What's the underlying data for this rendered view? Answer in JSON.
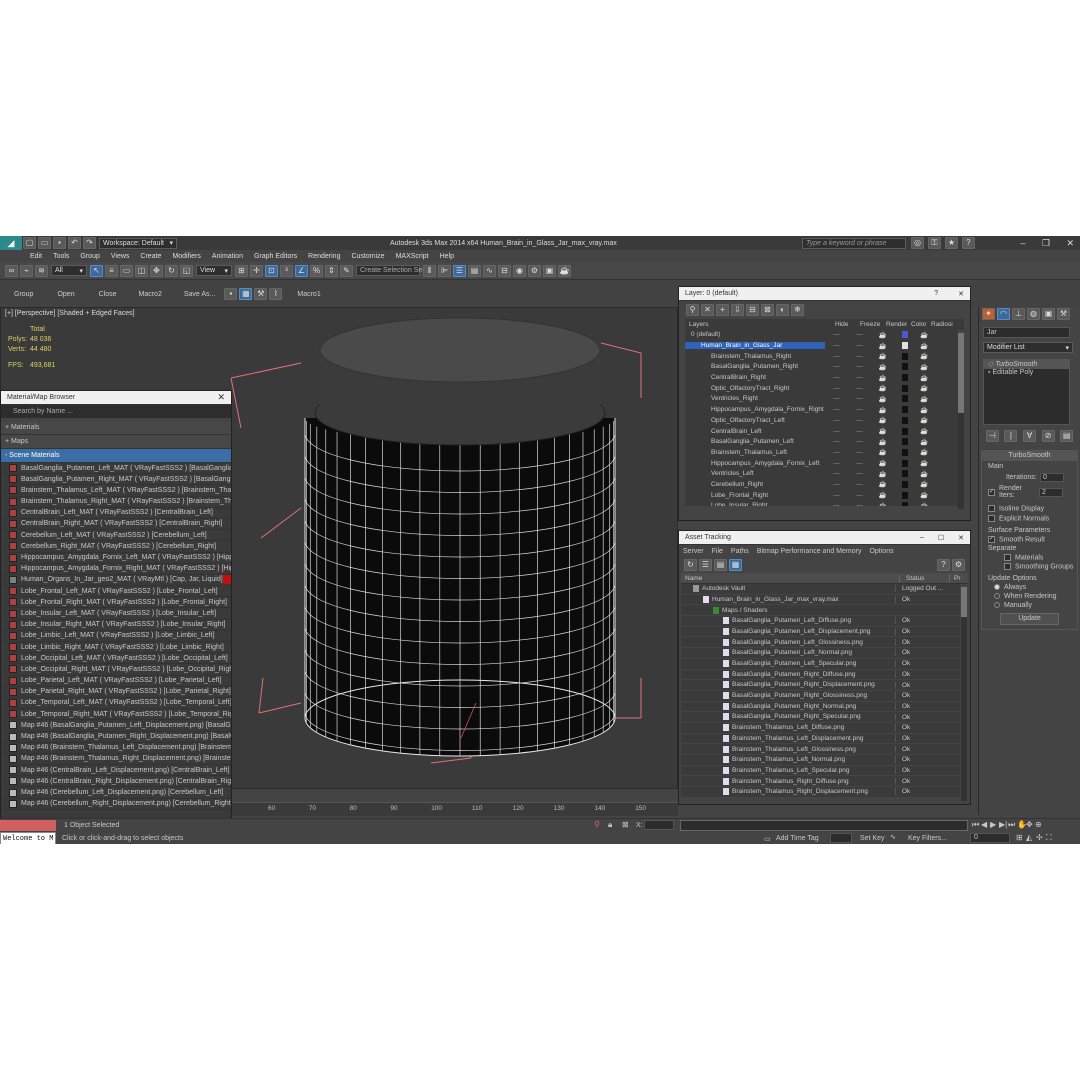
{
  "title_bar": {
    "workspace": "Workspace: Default",
    "title": "Autodesk 3ds Max 2014 x64     Human_Brain_in_Glass_Jar_max_vray.max",
    "search_placeholder": "Type a keyword or phrase"
  },
  "menu": [
    "Edit",
    "Tools",
    "Group",
    "Views",
    "Create",
    "Modifiers",
    "Animation",
    "Graph Editors",
    "Rendering",
    "Customize",
    "MAXScript",
    "Help"
  ],
  "main_toolbar": {
    "filter": "All",
    "view": "View",
    "selection_set": "Create Selection Se"
  },
  "quick_toolbar": [
    "Group",
    "Open",
    "Close",
    "Macro2",
    "Save As...",
    "Macro1"
  ],
  "viewport": {
    "label": "[+] [Perspective] [Shaded + Edged Faces]",
    "stats": {
      "total_label": "Total",
      "polys_label": "Polys:",
      "polys": "48 036",
      "verts_label": "Verts:",
      "verts": "44 480",
      "fps_label": "FPS:",
      "fps": "493,681"
    }
  },
  "timeline": {
    "ticks": [
      "60",
      "70",
      "80",
      "90",
      "100",
      "110",
      "120",
      "130",
      "140",
      "150"
    ]
  },
  "status": {
    "selected": "1 Object Selected",
    "prompt": "Click or click-and-drag to select objects",
    "welcome": "Welcome to M",
    "x_label": "X:",
    "add_time_tag": "Add Time Tag",
    "set_key": "Set Key",
    "key_filters": "Key Filters...",
    "frame": "0"
  },
  "material_browser": {
    "title": "Material/Map Browser",
    "search_placeholder": "Search by Name ...",
    "sections": [
      "+ Materials",
      "+ Maps",
      "- Scene Materials"
    ],
    "items": [
      {
        "text": "BasalGanglia_Putamen_Left_MAT ( VRayFastSSS2 ) [BasalGanglia_P...",
        "color": "#b04040"
      },
      {
        "text": "BasalGanglia_Putamen_Right_MAT ( VRayFastSSS2 ) [BasalGanglia_...",
        "color": "#b04040"
      },
      {
        "text": "Brainstem_Thalamus_Left_MAT ( VRayFastSSS2 ) [Brainstem_Thala...",
        "color": "#b04040"
      },
      {
        "text": "Brainstem_Thalamus_Right_MAT ( VRayFastSSS2 ) [Brainstem_Thal...",
        "color": "#b04040"
      },
      {
        "text": "CentralBrain_Left_MAT ( VRayFastSSS2 ) [CentralBrain_Left]",
        "color": "#b04040"
      },
      {
        "text": "CentralBrain_Right_MAT ( VRayFastSSS2 ) [CentralBrain_Right]",
        "color": "#b04040"
      },
      {
        "text": "Cerebellum_Left_MAT ( VRayFastSSS2 ) [Cerebellum_Left]",
        "color": "#b04040"
      },
      {
        "text": "Cerebellum_Right_MAT ( VRayFastSSS2 ) [Cerebellum_Right]",
        "color": "#b04040"
      },
      {
        "text": "Hippocampus_Amygdala_Fornix_Left_MAT ( VRayFastSSS2 ) [Hippo...",
        "color": "#b04040"
      },
      {
        "text": "Hippocampus_Amygdala_Fornix_Right_MAT ( VRayFastSSS2 ) [Hipp...",
        "color": "#b04040"
      },
      {
        "text": "Human_Organs_In_Jar_geo2_MAT ( VRayMtl ) [Cap, Jar, Liquid]",
        "color": "#808080",
        "tag": true
      },
      {
        "text": "Lobe_Frontal_Left_MAT ( VRayFastSSS2 ) [Lobe_Frontal_Left]",
        "color": "#b04040"
      },
      {
        "text": "Lobe_Frontal_Right_MAT ( VRayFastSSS2 ) [Lobe_Frontal_Right]",
        "color": "#b04040"
      },
      {
        "text": "Lobe_Insular_Left_MAT ( VRayFastSSS2 ) [Lobe_Insular_Left]",
        "color": "#b04040"
      },
      {
        "text": "Lobe_Insular_Right_MAT ( VRayFastSSS2 ) [Lobe_Insular_Right]",
        "color": "#b04040"
      },
      {
        "text": "Lobe_Limbic_Left_MAT ( VRayFastSSS2 ) [Lobe_Limbic_Left]",
        "color": "#b04040"
      },
      {
        "text": "Lobe_Limbic_Right_MAT ( VRayFastSSS2 ) [Lobe_Limbic_Right]",
        "color": "#b04040"
      },
      {
        "text": "Lobe_Occipital_Left_MAT ( VRayFastSSS2 ) [Lobe_Occipital_Left]",
        "color": "#b04040"
      },
      {
        "text": "Lobe_Occipital_Right_MAT ( VRayFastSSS2 ) [Lobe_Occipital_Right]",
        "color": "#b04040"
      },
      {
        "text": "Lobe_Parietal_Left_MAT ( VRayFastSSS2 ) [Lobe_Parietal_Left]",
        "color": "#b04040"
      },
      {
        "text": "Lobe_Parietal_Right_MAT ( VRayFastSSS2 ) [Lobe_Parietal_Right]",
        "color": "#b04040"
      },
      {
        "text": "Lobe_Temporal_Left_MAT ( VRayFastSSS2 ) [Lobe_Temporal_Left]",
        "color": "#b04040"
      },
      {
        "text": "Lobe_Temporal_Right_MAT ( VRayFastSSS2 ) [Lobe_Temporal_Right]",
        "color": "#b04040"
      },
      {
        "text": "Map #46 (BasalGanglia_Putamen_Left_Displacement.png) [BasalGan...",
        "color": "#bbbbbb"
      },
      {
        "text": "Map #46 (BasalGanglia_Putamen_Right_Displacement.png) [BasalG...",
        "color": "#bbbbbb"
      },
      {
        "text": "Map #46 (Brainstem_Thalamus_Left_Displacement.png) [Brainstem...",
        "color": "#bbbbbb"
      },
      {
        "text": "Map #46 (Brainstem_Thalamus_Right_Displacement.png) [Brainste...",
        "color": "#bbbbbb"
      },
      {
        "text": "Map #46 (CentralBrain_Left_Displacement.png) [CentralBrain_Left]",
        "color": "#bbbbbb"
      },
      {
        "text": "Map #46 (CentralBrain_Right_Displacement.png) [CentralBrain_Right]",
        "color": "#bbbbbb"
      },
      {
        "text": "Map #46 (Cerebellum_Left_Displacement.png) [Cerebellum_Left]",
        "color": "#bbbbbb"
      },
      {
        "text": "Map #46 (Cerebellum_Right_Displacement.png) [Cerebellum_Right]",
        "color": "#bbbbbb"
      }
    ]
  },
  "layer_manager": {
    "title": "Layer: 0 (default)",
    "columns": [
      "Layers",
      "Hide",
      "Freeze",
      "Render",
      "Color",
      "Radiosi"
    ],
    "rows": [
      {
        "name": "0 (default)",
        "level": 0,
        "color": "#4a5ad0"
      },
      {
        "name": "Human_Brain_in_Glass_Jar",
        "level": 1,
        "selected": true,
        "color": "#e0e0e0"
      },
      {
        "name": "Brainstem_Thalamus_Right",
        "level": 2,
        "color": "#111111"
      },
      {
        "name": "BasalGanglia_Putamen_Right",
        "level": 2,
        "color": "#111111"
      },
      {
        "name": "CentralBrain_Right",
        "level": 2,
        "color": "#111111"
      },
      {
        "name": "Optic_OlfactoryTract_Right",
        "level": 2,
        "color": "#111111"
      },
      {
        "name": "Ventricles_Right",
        "level": 2,
        "color": "#111111"
      },
      {
        "name": "Hippocampus_Amygdala_Fornix_Right",
        "level": 2,
        "color": "#111111"
      },
      {
        "name": "Optic_OlfactoryTract_Left",
        "level": 2,
        "color": "#111111"
      },
      {
        "name": "CentralBrain_Left",
        "level": 2,
        "color": "#111111"
      },
      {
        "name": "BasalGanglia_Putamen_Left",
        "level": 2,
        "color": "#111111"
      },
      {
        "name": "Brainstem_Thalamus_Left",
        "level": 2,
        "color": "#111111"
      },
      {
        "name": "Hippocampus_Amygdala_Fornix_Left",
        "level": 2,
        "color": "#111111"
      },
      {
        "name": "Ventricles_Left",
        "level": 2,
        "color": "#111111"
      },
      {
        "name": "Cerebellum_Right",
        "level": 2,
        "color": "#111111"
      },
      {
        "name": "Lobe_Frontal_Right",
        "level": 2,
        "color": "#111111"
      },
      {
        "name": "Lobe_Insular_Right",
        "level": 2,
        "color": "#111111"
      }
    ]
  },
  "asset_tracking": {
    "title": "Asset Tracking",
    "menu": [
      "Server",
      "File",
      "Paths",
      "Bitmap Performance and Memory",
      "Options"
    ],
    "columns": [
      "Name",
      "Status",
      "Pr"
    ],
    "rows": [
      {
        "name": "Autodesk Vault",
        "status": "Logged Out ...",
        "level": 0
      },
      {
        "name": "Human_Brain_in_Glass_Jar_max_vray.max",
        "status": "Ok",
        "level": 1
      },
      {
        "name": "Maps / Shaders",
        "status": "",
        "level": 2
      },
      {
        "name": "BasalGanglia_Putamen_Left_Diffuse.png",
        "status": "Ok",
        "level": 3
      },
      {
        "name": "BasalGanglia_Putamen_Left_Displacement.png",
        "status": "Ok",
        "level": 3
      },
      {
        "name": "BasalGanglia_Putamen_Left_Glossiness.png",
        "status": "Ok",
        "level": 3
      },
      {
        "name": "BasalGanglia_Putamen_Left_Normal.png",
        "status": "Ok",
        "level": 3
      },
      {
        "name": "BasalGanglia_Putamen_Left_Specular.png",
        "status": "Ok",
        "level": 3
      },
      {
        "name": "BasalGanglia_Putamen_Right_Diffuse.png",
        "status": "Ok",
        "level": 3
      },
      {
        "name": "BasalGanglia_Putamen_Right_Displacement.png",
        "status": "Ok",
        "level": 3
      },
      {
        "name": "BasalGanglia_Putamen_Right_Glossiness.png",
        "status": "Ok",
        "level": 3
      },
      {
        "name": "BasalGanglia_Putamen_Right_Normal.png",
        "status": "Ok",
        "level": 3
      },
      {
        "name": "BasalGanglia_Putamen_Right_Specular.png",
        "status": "Ok",
        "level": 3
      },
      {
        "name": "Brainstem_Thalamus_Left_Diffuse.png",
        "status": "Ok",
        "level": 3
      },
      {
        "name": "Brainstem_Thalamus_Left_Displacement.png",
        "status": "Ok",
        "level": 3
      },
      {
        "name": "Brainstem_Thalamus_Left_Glossiness.png",
        "status": "Ok",
        "level": 3
      },
      {
        "name": "Brainstem_Thalamus_Left_Normal.png",
        "status": "Ok",
        "level": 3
      },
      {
        "name": "Brainstem_Thalamus_Left_Specular.png",
        "status": "Ok",
        "level": 3
      },
      {
        "name": "Brainstem_Thalamus_Right_Diffuse.png",
        "status": "Ok",
        "level": 3
      },
      {
        "name": "Brainstem_Thalamus_Right_Displacement.png",
        "status": "Ok",
        "level": 3
      }
    ]
  },
  "command_panel": {
    "object_name": "Jar",
    "modifier_list": "Modifier List",
    "stack": [
      "TurboSmooth",
      "Editable Poly"
    ],
    "rollout": "TurboSmooth",
    "main": "Main",
    "iterations_label": "Iterations:",
    "iterations": "0",
    "render_iters_label": "Render Iters:",
    "render_iters": "2",
    "isoline": "Isoline Display",
    "explicit": "Explicit Normals",
    "surface_params": "Surface Parameters",
    "smooth_result": "Smooth Result",
    "separate": "Separate",
    "sep_materials": "Materials",
    "sep_smoothing": "Smoothing Groups",
    "update_options": "Update Options",
    "always": "Always",
    "when_rendering": "When Rendering",
    "manually": "Manually",
    "update_btn": "Update"
  }
}
